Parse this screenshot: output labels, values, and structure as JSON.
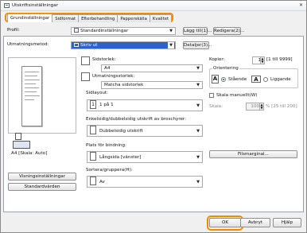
{
  "window": {
    "title": "Utskriftsinställningar",
    "close": "✕"
  },
  "tabs": [
    {
      "label": "Grundinställningar"
    },
    {
      "label": "Sidformat"
    },
    {
      "label": "Efterbehandling"
    },
    {
      "label": "Papperskälla"
    },
    {
      "label": "Kvalitet"
    }
  ],
  "profile": {
    "label": "Profil:",
    "value": "Standardinställningar",
    "add_button": "Lägg till(1)...",
    "edit_button": "Redigera(2)..."
  },
  "output_method": {
    "label": "Utmatningsmetod:",
    "value": "Skriv ut",
    "details_button": "Detaljer(3)..."
  },
  "page_size": {
    "label": "Sidstorlek:",
    "value": "A4"
  },
  "output_size": {
    "label": "Utmatningsstorlek:",
    "value": "Matcha sidstorlek"
  },
  "copies": {
    "label": "Kopior:",
    "value": "1",
    "range": "[1 till 9999]"
  },
  "orientation": {
    "title": "Orientering",
    "portrait_icon": "A",
    "portrait": "Stående",
    "landscape_icon": "A",
    "landscape": "Liggande"
  },
  "layout": {
    "label": "Sidlayout:",
    "value": "1 på 1",
    "icon": "1"
  },
  "manual_scale": {
    "label": "Skala manuellt(W)",
    "scale_label": "Skala:",
    "value": "100",
    "range": "% [25 till 200]"
  },
  "duplex": {
    "label": "Enkelsidig/dubbelsidig utskrift av broschyrer:",
    "value": "Dubbelsidig utskrift"
  },
  "binding": {
    "label": "Plats för bindning:",
    "value": "Långsida [vänster]"
  },
  "collate": {
    "label": "Sortera/gruppera(H):",
    "value": "Av"
  },
  "watermark_button": "Filsmarginal...",
  "preview_caption": "A4 [Skala: Auto]",
  "printer_settings_button": "Visningsinställningar",
  "restore_defaults_button": "Standardvärden",
  "footer": {
    "ok": "OK",
    "cancel": "Avbryt",
    "help": "Hjälp"
  }
}
